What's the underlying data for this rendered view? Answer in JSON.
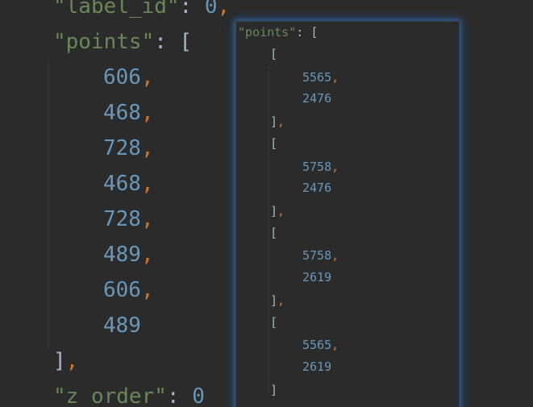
{
  "editor": {
    "label_key": "\"label_id\"",
    "label_colon": ": ",
    "label_value": "0",
    "label_comma": ",",
    "points_key": "\"points\"",
    "points_colon": ": ",
    "points_open": "[",
    "values": [
      "606",
      "468",
      "728",
      "468",
      "728",
      "489",
      "606",
      "489"
    ],
    "comma": ",",
    "close": "]",
    "close_comma": ",",
    "z_key": "\"z_order\"",
    "z_colon": ": ",
    "z_value": "0"
  },
  "popup": {
    "points_key": "\"points\"",
    "colon": ": ",
    "open": "[",
    "comma": ",",
    "groups": [
      {
        "open": "[",
        "x": "5565",
        "y": "2476",
        "close": "]"
      },
      {
        "open": "[",
        "x": "5758",
        "y": "2476",
        "close": "]"
      },
      {
        "open": "[",
        "x": "5758",
        "y": "2619",
        "close": "]"
      },
      {
        "open": "[",
        "x": "5565",
        "y": "2619",
        "close": "]"
      }
    ]
  }
}
